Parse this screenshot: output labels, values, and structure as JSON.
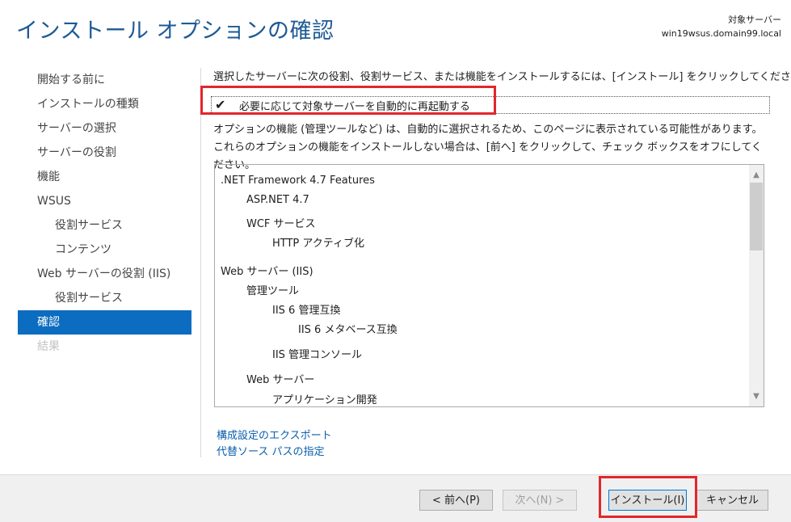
{
  "header": {
    "title": "インストール オプションの確認",
    "server_label": "対象サーバー",
    "server_name": "win19wsus.domain99.local"
  },
  "nav": [
    {
      "label": "開始する前に",
      "state": "normal"
    },
    {
      "label": "インストールの種類",
      "state": "normal"
    },
    {
      "label": "サーバーの選択",
      "state": "normal"
    },
    {
      "label": "サーバーの役割",
      "state": "normal"
    },
    {
      "label": "機能",
      "state": "normal"
    },
    {
      "label": "WSUS",
      "state": "normal"
    },
    {
      "label": "役割サービス",
      "state": "sub"
    },
    {
      "label": "コンテンツ",
      "state": "sub"
    },
    {
      "label": "Web サーバーの役割 (IIS)",
      "state": "normal"
    },
    {
      "label": "役割サービス",
      "state": "sub"
    },
    {
      "label": "確認",
      "state": "active"
    },
    {
      "label": "結果",
      "state": "disabled"
    }
  ],
  "main": {
    "description": "選択したサーバーに次の役割、役割サービス、または機能をインストールするには、[インストール] をクリックしてください。",
    "restart_checkbox": {
      "label": "必要に応じて対象サーバーを自動的に再起動する",
      "checked": true,
      "check_glyph": "✔"
    },
    "note": "オプションの機能 (管理ツールなど) は、自動的に選択されるため、このページに表示されている可能性があります。これらのオプションの機能をインストールしない場合は、[前へ] をクリックして、チェック ボックスをオフにしてください。",
    "features": [
      {
        "label": ".NET Framework 4.7 Features",
        "level": 0
      },
      {
        "label": "ASP.NET 4.7",
        "level": 1
      },
      {
        "label": "WCF サービス",
        "level": 1
      },
      {
        "label": "HTTP アクティブ化",
        "level": 2
      },
      {
        "label": "Web サーバー (IIS)",
        "level": 0
      },
      {
        "label": "管理ツール",
        "level": 1
      },
      {
        "label": "IIS 6 管理互換",
        "level": 2
      },
      {
        "label": "IIS 6 メタベース互換",
        "level": 3
      },
      {
        "label": "IIS 管理コンソール",
        "level": 2
      },
      {
        "label": "Web サーバー",
        "level": 1
      },
      {
        "label": "アプリケーション開発",
        "level": 2
      }
    ],
    "links": {
      "export": "構成設定のエクスポート",
      "alt_source": "代替ソース パスの指定"
    },
    "scroll_up_icon": "▲",
    "scroll_down_icon": "▼"
  },
  "footer": {
    "prev": "< 前へ(P)",
    "next": "次へ(N) >",
    "install": "インストール(I)",
    "cancel": "キャンセル"
  },
  "colors": {
    "accent": "#0b6cc0",
    "highlight": "#e2262c",
    "link": "#0b5fad"
  }
}
